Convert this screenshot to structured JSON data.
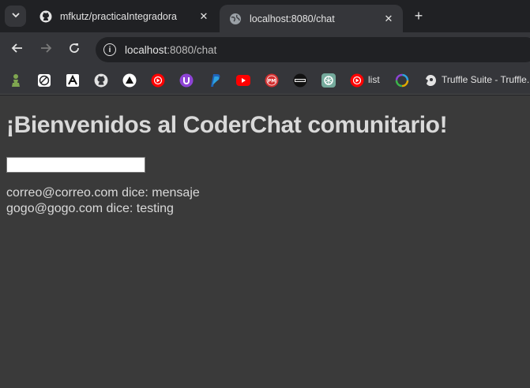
{
  "browser": {
    "tabs": [
      {
        "title": "mfkutz/practicaIntegradora",
        "icon": "github-icon",
        "active": false
      },
      {
        "title": "localhost:8080/chat",
        "icon": "globe-icon",
        "active": true
      }
    ],
    "address": {
      "host": "localhost",
      "path": ":8080/chat"
    },
    "bookmarks": [
      {
        "icon": "chess-pawn-icon"
      },
      {
        "icon": "deno-icon"
      },
      {
        "icon": "a-logo-icon"
      },
      {
        "icon": "github-icon"
      },
      {
        "icon": "triangle-icon"
      },
      {
        "icon": "youtube-music-icon"
      },
      {
        "icon": "purple-u-icon"
      },
      {
        "icon": "paypal-icon"
      },
      {
        "icon": "youtube-icon"
      },
      {
        "icon": "pm-icon"
      },
      {
        "icon": "badge-icon"
      },
      {
        "icon": "openai-icon"
      },
      {
        "icon": "youtube-music-list-icon",
        "label": "list"
      },
      {
        "icon": "color-ring-icon"
      },
      {
        "icon": "truffle-icon",
        "label": "Truffle Suite - Truffle..."
      }
    ]
  },
  "page": {
    "heading": "¡Bienvenidos al CoderChat comunitario!",
    "input_value": "",
    "messages": [
      {
        "text": "correo@correo.com dice: mensaje"
      },
      {
        "text": "gogo@gogo.com dice: testing"
      }
    ]
  },
  "colors": {
    "page_background": "#3a3a3a",
    "text": "#d9d9d9",
    "chrome_dark": "#202124",
    "chrome_toolbar": "#35363a"
  }
}
